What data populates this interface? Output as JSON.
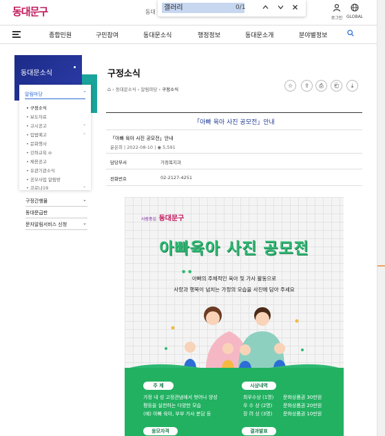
{
  "site": {
    "logo": "동대문구",
    "gu_label": "동대"
  },
  "findbar": {
    "query": "갤러리",
    "count": "0/1",
    "prev_icon": "chevron-up-icon",
    "next_icon": "chevron-down-icon",
    "close_icon": "close-icon"
  },
  "header_utils": [
    {
      "label": "로그인",
      "icon": "user-icon"
    },
    {
      "label": "GLOBAL",
      "icon": "globe-icon"
    }
  ],
  "nav": {
    "items": [
      "종합민원",
      "구민참여",
      "동대문소식",
      "행정정보",
      "동대문소개",
      "분야별정보"
    ]
  },
  "sidebar": {
    "title": "동대문소식",
    "section": "알림마당",
    "sub_items": [
      {
        "label": "• 구정소식",
        "active": true,
        "caret": false
      },
      {
        "label": "• 보도자료",
        "active": false,
        "caret": false
      },
      {
        "label": "• 고시공고",
        "active": false,
        "caret": true
      },
      {
        "label": "• 입법예고",
        "active": false,
        "caret": true
      },
      {
        "label": "• 문화행사",
        "active": false,
        "caret": false
      },
      {
        "label": "• 강좌교육 ⊘",
        "active": false,
        "caret": false
      },
      {
        "label": "• 채용공고",
        "active": false,
        "caret": false
      },
      {
        "label": "• 유관기관소식",
        "active": false,
        "caret": false
      },
      {
        "label": "• 공모사업 알림방",
        "active": false,
        "caret": false
      },
      {
        "label": "• 코로나19",
        "active": false,
        "caret": true
      }
    ],
    "items": [
      {
        "label": "구정간행물",
        "caret": true
      },
      {
        "label": "동대문급판",
        "caret": false
      },
      {
        "label": "문자알림서비스 신청",
        "caret": true
      }
    ]
  },
  "content": {
    "title": "구정소식",
    "breadcrumb": [
      "⌂",
      "동대문소식",
      "알림마당",
      "구정소식"
    ],
    "tools": [
      "☆",
      "⇪",
      "⎙",
      "⎗",
      "⤓"
    ],
    "notice_title": "「아빠 육아 사진 공모전」안내",
    "post_title": "「아빠 육아 사진 공모전」안내",
    "author": "윤은희",
    "date": "2022-08-10",
    "views": "5,591",
    "rows": [
      {
        "label": "담당부서",
        "value": "가정복지과"
      },
      {
        "label": "전화번호",
        "value": "02-2127-4251"
      }
    ]
  },
  "poster": {
    "logo_small": "사람중심",
    "logo": "동대문구",
    "headline": "아빠육아 사진 공모전",
    "line1": "아빠의 주체적인 육아 및 가사 활동으로",
    "line2": "사랑과 행복이 넘치는 가정의 모습을 사진에 담아 주세요",
    "theme_pill": "주  제",
    "theme_lines": [
      "가정 내 성 고정관념에서 벗어나 양성",
      "평등을 실천하는 다양한 모습",
      "(예) 아빠 육아, 부부 가사 분담 등"
    ],
    "prize_pill": "시상내역",
    "prizes": [
      {
        "rank": "최우수상 (1명)",
        "reward": "문화상품권 30만원"
      },
      {
        "rank": "우 수 상 (2명)",
        "reward": "문화상품권 20만원"
      },
      {
        "rank": "장 려 상 (3명)",
        "reward": "문화상품권 10만원"
      }
    ],
    "eligibility_pill": "응모자격",
    "result_pill": "결과발표",
    "colors": {
      "green": "#22b161",
      "headline": "#2eb872"
    }
  }
}
